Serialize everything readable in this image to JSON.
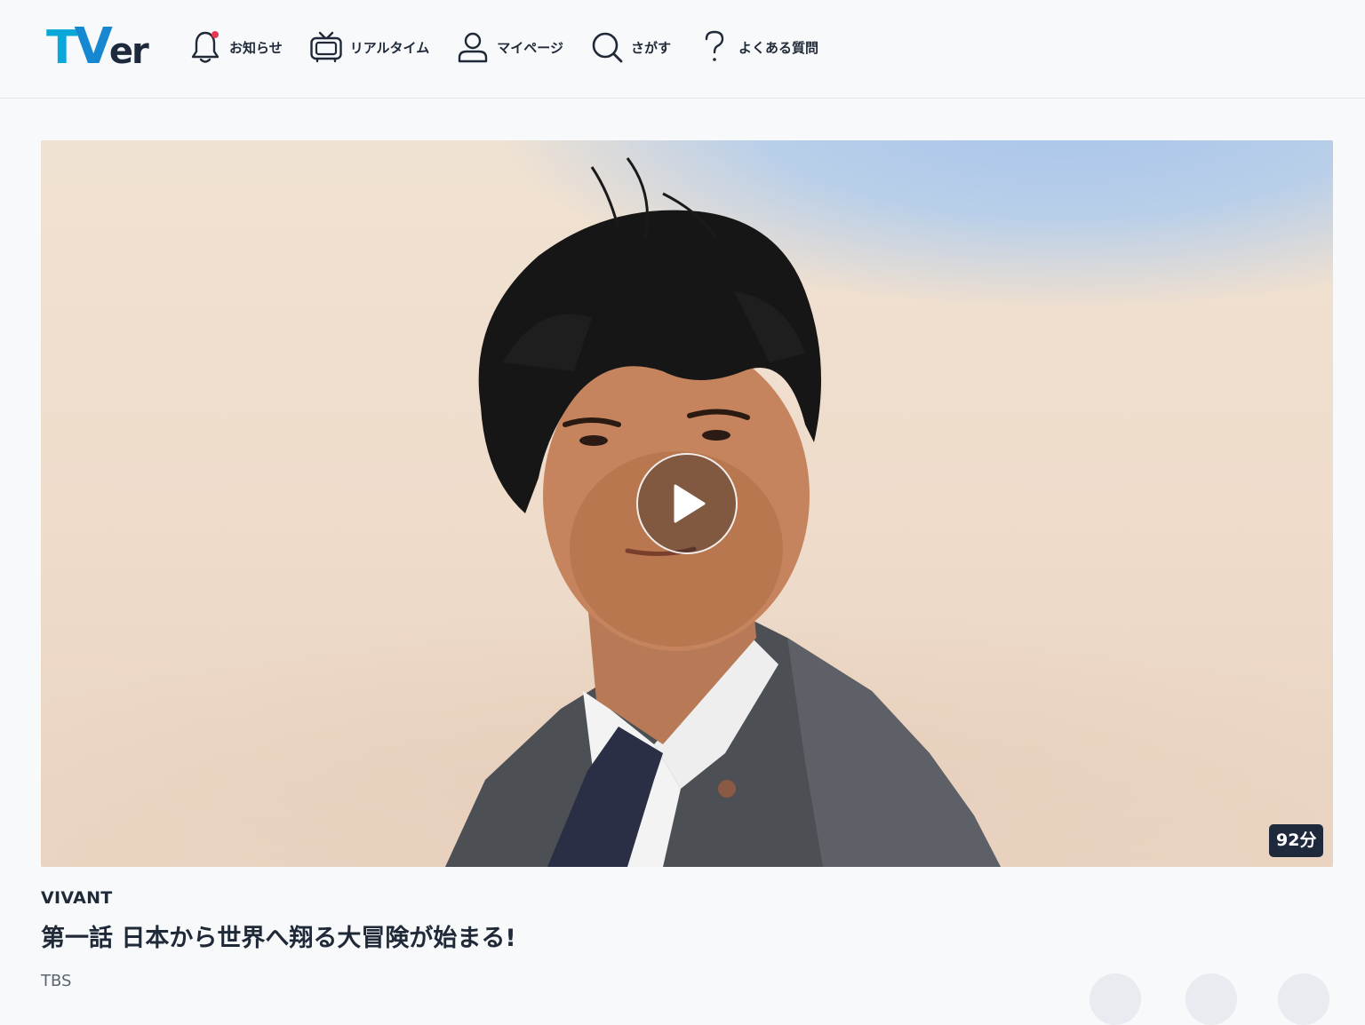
{
  "header": {
    "logo": "TVer",
    "nav": [
      {
        "label": "お知らせ",
        "icon": "bell-icon"
      },
      {
        "label": "リアルタイム",
        "icon": "tv-icon"
      },
      {
        "label": "マイページ",
        "icon": "user-icon"
      },
      {
        "label": "さがす",
        "icon": "search-icon"
      },
      {
        "label": "よくある質問",
        "icon": "question-icon"
      }
    ],
    "notification_dot_color": "#e8384f"
  },
  "hero": {
    "duration": "92分",
    "play_icon": "play-icon"
  },
  "episode": {
    "series": "VIVANT",
    "title": "第一話 日本から世界へ翔る大冒険が始まる!",
    "broadcaster": "TBS"
  },
  "colors": {
    "brand_cyan": "#0aa8d8",
    "brand_blue": "#1687d1",
    "text": "#1f2937",
    "badge_bg": "#1e2a3c"
  }
}
